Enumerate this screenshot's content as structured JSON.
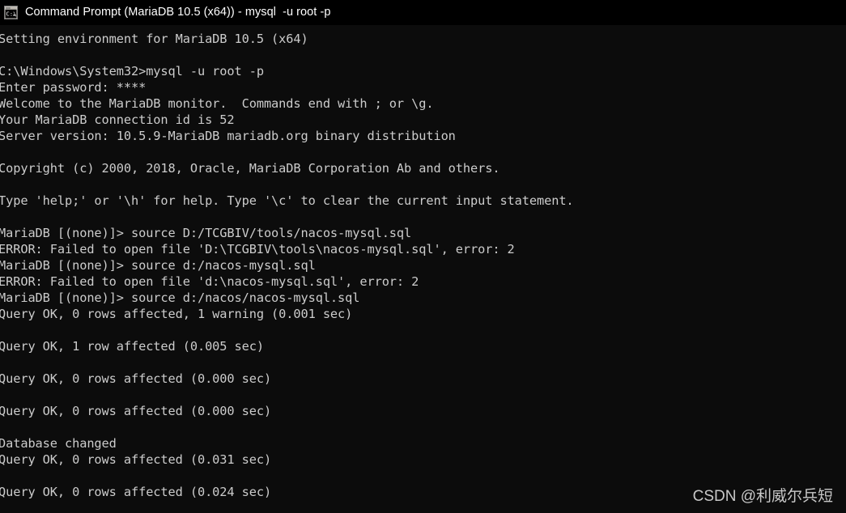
{
  "window": {
    "title": "Command Prompt (MariaDB 10.5 (x64)) - mysql  -u root -p",
    "icon": "console-window-icon",
    "titlebar_bg": "#000000",
    "console_bg": "#0c0c0c",
    "text_color": "#cccccc",
    "title_color": "#ffffff"
  },
  "console": {
    "lines": [
      "Setting environment for MariaDB 10.5 (x64)",
      "",
      "C:\\Windows\\System32>mysql -u root -p",
      "Enter password: ****",
      "Welcome to the MariaDB monitor.  Commands end with ; or \\g.",
      "Your MariaDB connection id is 52",
      "Server version: 10.5.9-MariaDB mariadb.org binary distribution",
      "",
      "Copyright (c) 2000, 2018, Oracle, MariaDB Corporation Ab and others.",
      "",
      "Type 'help;' or '\\h' for help. Type '\\c' to clear the current input statement.",
      "",
      "MariaDB [(none)]> source D:/TCGBIV/tools/nacos-mysql.sql",
      "ERROR: Failed to open file 'D:\\TCGBIV\\tools\\nacos-mysql.sql', error: 2",
      "MariaDB [(none)]> source d:/nacos-mysql.sql",
      "ERROR: Failed to open file 'd:\\nacos-mysql.sql', error: 2",
      "MariaDB [(none)]> source d:/nacos/nacos-mysql.sql",
      "Query OK, 0 rows affected, 1 warning (0.001 sec)",
      "",
      "Query OK, 1 row affected (0.005 sec)",
      "",
      "Query OK, 0 rows affected (0.000 sec)",
      "",
      "Query OK, 0 rows affected (0.000 sec)",
      "",
      "Database changed",
      "Query OK, 0 rows affected (0.031 sec)",
      "",
      "Query OK, 0 rows affected (0.024 sec)"
    ]
  },
  "watermark": {
    "text": "CSDN @利威尔兵短"
  }
}
